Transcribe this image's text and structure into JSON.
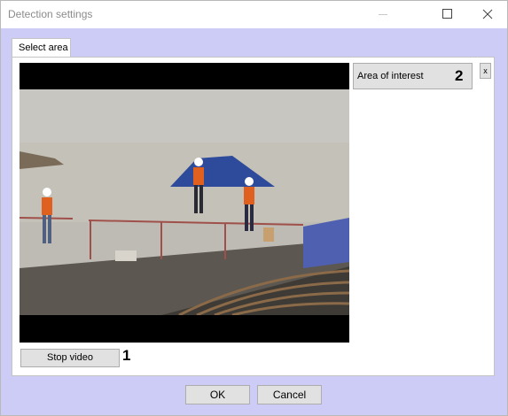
{
  "window": {
    "title": "Detection settings"
  },
  "tabs": [
    {
      "label": "Select area"
    }
  ],
  "video": {
    "stop_label": "Stop video",
    "callout_stop": "1"
  },
  "area_panel": {
    "area_label": "Area of interest",
    "callout_area": "2",
    "remove_label": "x"
  },
  "footer": {
    "ok_label": "OK",
    "cancel_label": "Cancel"
  },
  "colors": {
    "dialog_bg": "#ccccf7",
    "button_face": "#e1e1e1",
    "button_border": "#adadad"
  },
  "icons": [
    "minimize-icon",
    "maximize-icon",
    "close-icon"
  ]
}
